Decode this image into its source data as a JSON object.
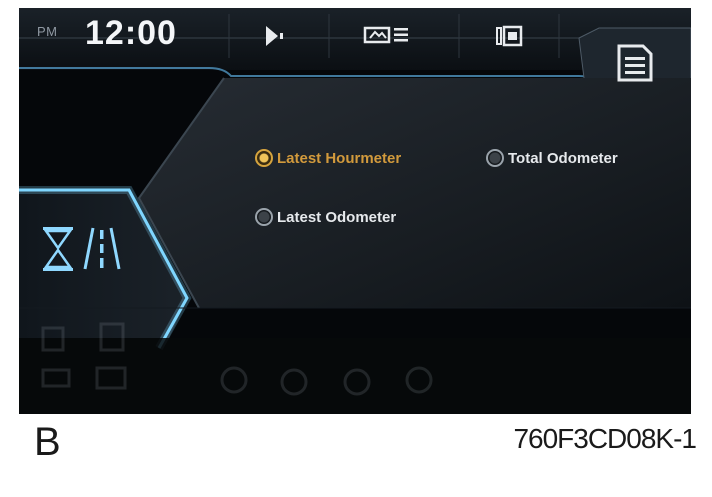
{
  "status_bar": {
    "ampm": "PM",
    "time": "12:00",
    "icons": [
      "play-icon",
      "display-menu-icon",
      "camera-icon",
      "menu-document-icon"
    ]
  },
  "mode_icons": [
    "hourglass-icon",
    "road-icon"
  ],
  "options": {
    "latest_hourmeter": {
      "label": "Latest Hourmeter",
      "selected": true
    },
    "total_odometer": {
      "label": "Total Odometer",
      "selected": false
    },
    "latest_odometer": {
      "label": "Latest Odometer",
      "selected": false
    }
  },
  "colors": {
    "accent": "#d29a3c",
    "highlight_blue": "#7fd6ff",
    "text": "#e6e9ec"
  },
  "caption": {
    "figure_letter": "B",
    "figure_code": "760F3CD08K-1"
  }
}
